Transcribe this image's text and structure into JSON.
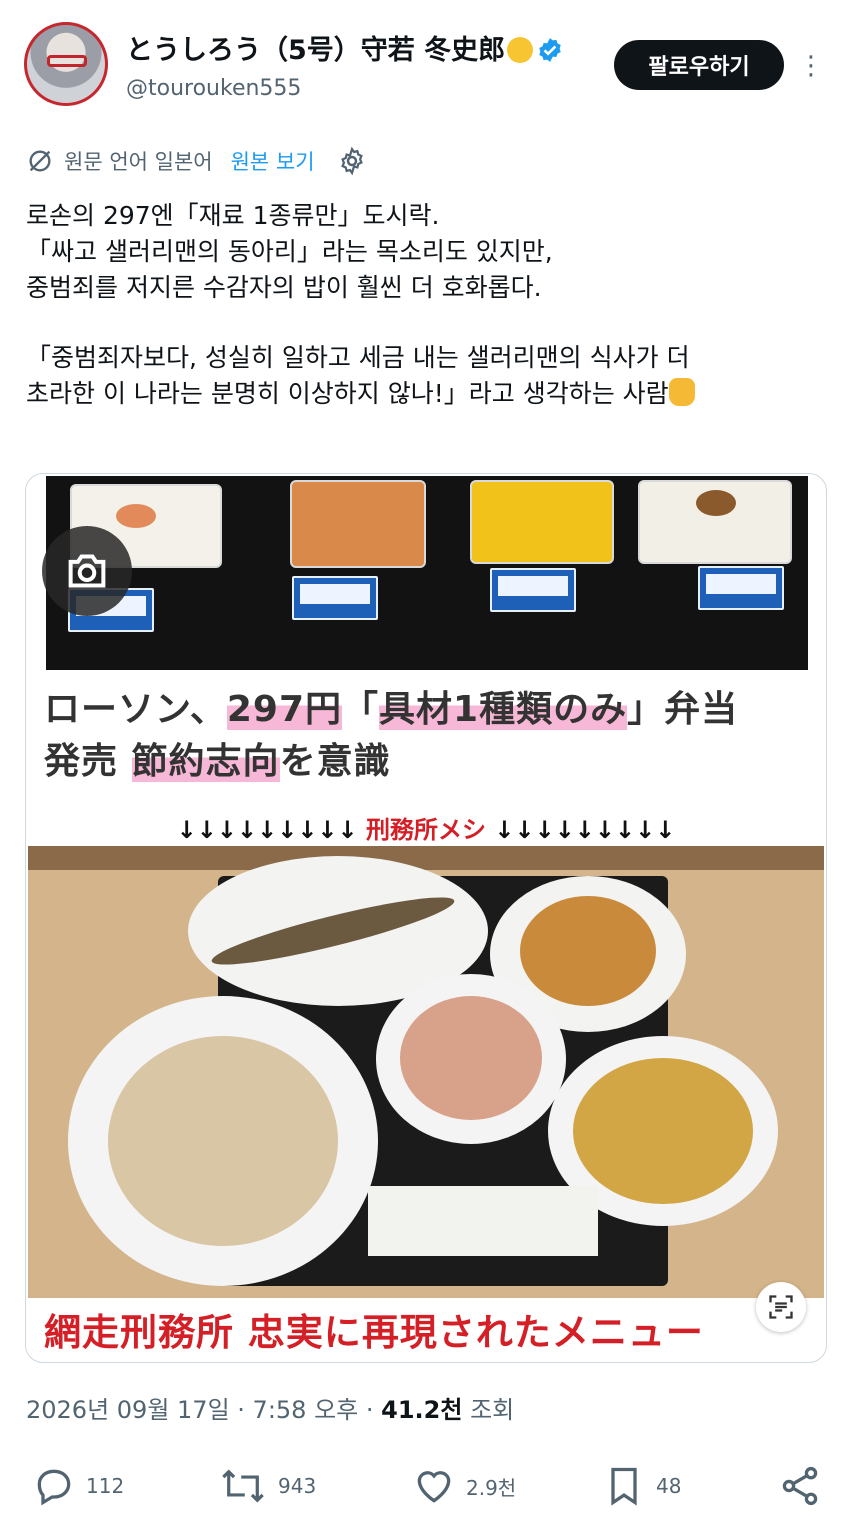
{
  "author": {
    "display_name": "とうしろう（5号）守若 冬史郎",
    "handle": "@tourouken555",
    "follow_label": "팔로우하기"
  },
  "translation": {
    "note": "원문 언어 일본어",
    "view_original": "원본 보기"
  },
  "tweet": {
    "lines": [
      "로손의 297엔「재료 1종류만」도시락.",
      "「싸고 샐러리맨의 동아리」라는 목소리도 있지만,",
      "중범죄를 저지른 수감자의 밥이 훨씬 더 호화롭다.",
      "「중범죄자보다, 성실히 일하고 세금 내는 샐러리맨의 식사가 더",
      "초라한 이 나라는 분명히 이상하지 않나!」라고 생각하는 사람"
    ]
  },
  "image": {
    "headline_a1": "ローソン、",
    "headline_a2": "297円",
    "headline_a3": "「",
    "headline_a4": "具材1種類のみ",
    "headline_a5": "」弁当",
    "headline_b1": "発売 ",
    "headline_b2": "節約志向",
    "headline_b3": "を意識",
    "arrows_left": "↓↓↓↓↓↓↓↓↓",
    "arrows_label": "刑務所メシ",
    "arrows_right": "↓↓↓↓↓↓↓↓↓",
    "caption": "網走刑務所 忠実に再現されたメニュー"
  },
  "meta": {
    "date": "2026년 09월 17일",
    "time": "7:58 오후",
    "views": "41.2천",
    "views_label": "조회"
  },
  "actions": {
    "replies": "112",
    "retweets": "943",
    "likes": "2.9천",
    "bookmarks": "48"
  },
  "colors": {
    "accent": "#1d9bf0",
    "text": "#0f1419",
    "muted": "#536471",
    "caption_red": "#d41f26",
    "highlight_pink": "#f7b7d6"
  }
}
